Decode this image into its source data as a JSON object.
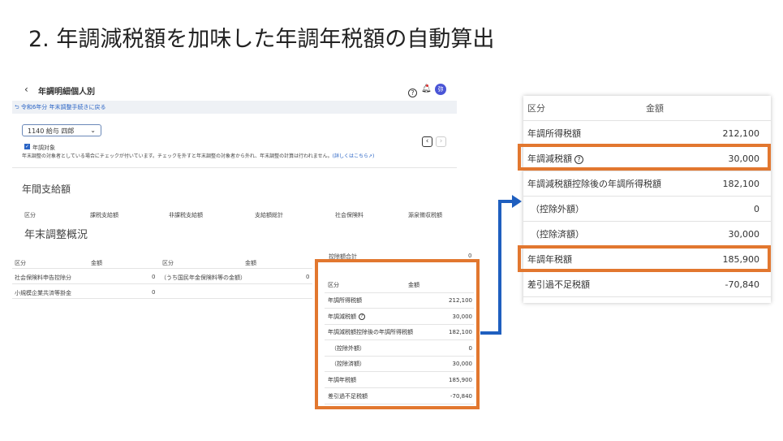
{
  "slide_title": "2. 年調減税額を加味した年調年税額の自動算出",
  "app": {
    "page_title": "年調明細個人別",
    "back_link": "令和6年分 年末調整手続きに戻る",
    "avatar": "弥",
    "employee_select": "1140 給与 四郎",
    "checkbox_label": "年調対象",
    "checkbox_checked": true,
    "notice": "年末調整の対象者としている場合にチェックが付いています。チェックを外すと年末調整の対象者から外れ、年末調整の計算は行われません。",
    "notice_link": "(詳しくはこちら",
    "annual_pay": {
      "heading": "年間支給額",
      "columns": [
        "区分",
        "課税支給額",
        "非課税支給額",
        "支給額総計",
        "社会保険料",
        "源泉徴収税額"
      ]
    },
    "overview": {
      "heading": "年末調整概況",
      "left_headers": [
        "区分",
        "金額",
        "区分",
        "金額"
      ],
      "rows": [
        [
          "社会保険料申告控除分",
          "0",
          "（うち国民年金保険料等の金額）",
          "0"
        ],
        [
          "小規模企業共済等掛金",
          "0",
          "",
          ""
        ]
      ],
      "deduction_total_label": "控除額合計",
      "deduction_total_value": "0"
    }
  },
  "tax_table": {
    "headers": [
      "区分",
      "金額"
    ],
    "rows": [
      {
        "label": "年調所得税額",
        "value": "212,100"
      },
      {
        "label": "年調減税額",
        "value": "30,000",
        "help": true
      },
      {
        "label": "年調減税額控除後の年調所得税額",
        "value": "182,100"
      },
      {
        "label": "（控除外額）",
        "value": "0"
      },
      {
        "label": "（控除済額）",
        "value": "30,000"
      },
      {
        "label": "年調年税額",
        "value": "185,900"
      },
      {
        "label": "差引過不足税額",
        "value": "-70,840"
      }
    ]
  },
  "colors": {
    "highlight": "#e2772f",
    "arrow": "#1f5fbf",
    "link": "#2a64c5",
    "avatar": "#4a55d6"
  }
}
